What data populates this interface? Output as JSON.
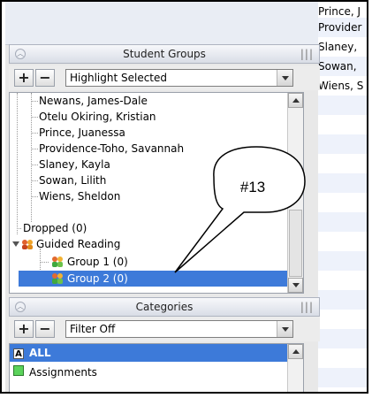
{
  "student_groups_panel": {
    "title": "Student Groups",
    "add_label": "+",
    "remove_label": "−",
    "dropdown_value": "Highlight Selected",
    "tree_items": [
      {
        "label": "Newans, James-Dale"
      },
      {
        "label": "Otelu Okiring, Kristian"
      },
      {
        "label": "Prince, Juanessa"
      },
      {
        "label": "Providence-Toho, Savannah"
      },
      {
        "label": "Slaney, Kayla"
      },
      {
        "label": "Sowan, Lilith"
      },
      {
        "label": "Wiens, Sheldon"
      },
      {
        "label": "Dropped (0)"
      },
      {
        "label": "Guided Reading"
      },
      {
        "label": "Group 1 (0)"
      },
      {
        "label": "Group 2 (0)",
        "selected": true
      }
    ]
  },
  "categories_panel": {
    "title": "Categories",
    "add_label": "+",
    "remove_label": "−",
    "dropdown_value": "Filter Off",
    "items": [
      {
        "label": "ALL",
        "selected": true,
        "icon": "all-icon"
      },
      {
        "label": "Assignments",
        "icon": "assignments-icon"
      }
    ]
  },
  "right_pane": {
    "rows": [
      "Prince, J",
      "Provider",
      "Slaney,",
      "Sowan,",
      "Wiens, S"
    ]
  },
  "callout": {
    "label": "#13"
  },
  "colors": {
    "selection": "#3d7ad9"
  }
}
